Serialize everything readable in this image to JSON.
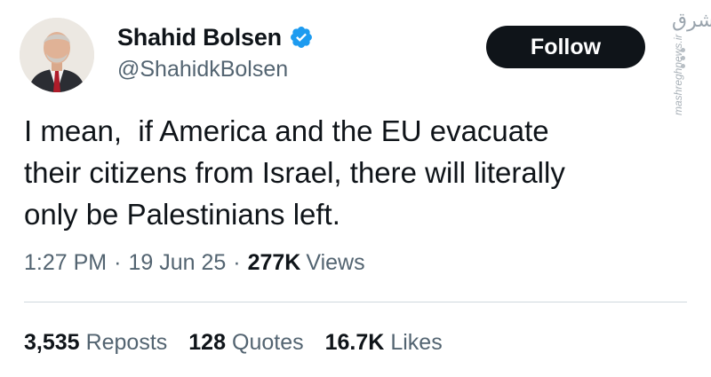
{
  "author": {
    "display_name": "Shahid Bolsen",
    "handle": "@ShahidkBolsen",
    "verified": true,
    "verified_icon": "verified-badge-icon"
  },
  "follow_label": "Follow",
  "tweet": {
    "text_lines": [
      "I mean,  if America and the EU evacuate",
      "their citizens from Israel, there will literally",
      "only be Palestinians left."
    ]
  },
  "meta": {
    "time": "1:27 PM",
    "separator": "·",
    "date": "19 Jun 25",
    "views_count": "277K",
    "views_label": "Views"
  },
  "stats": [
    {
      "count": "3,535",
      "label": "Reposts"
    },
    {
      "count": "128",
      "label": "Quotes"
    },
    {
      "count": "16.7K",
      "label": "Likes"
    }
  ],
  "watermark": {
    "logo": "مشرق",
    "text": "mashreghnews.ir"
  },
  "colors": {
    "text_primary": "#0f1419",
    "text_secondary": "#536471",
    "verified_blue": "#1d9bf0",
    "follow_bg": "#0f1419",
    "divider": "#cfd9de"
  }
}
